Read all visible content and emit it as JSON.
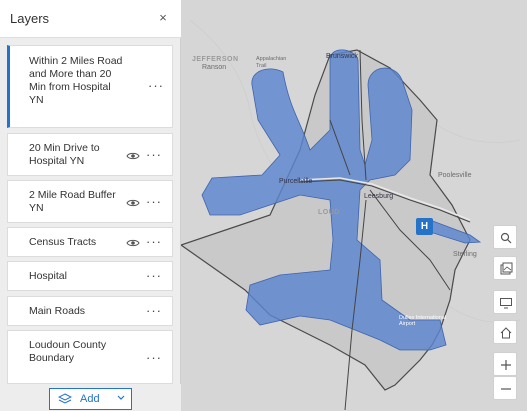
{
  "panel": {
    "title": "Layers",
    "close_glyph": "×",
    "layers": [
      {
        "label": "Within 2 Miles Road and More than 20 Min from Hospital YN",
        "visible_toggle": false,
        "active": true
      },
      {
        "label": "20 Min Drive to Hospital YN",
        "visible_toggle": true
      },
      {
        "label": "2 Mile Road Buffer YN",
        "visible_toggle": true
      },
      {
        "label": "Census Tracts",
        "visible_toggle": true
      },
      {
        "label": "Hospital",
        "visible_toggle": false
      },
      {
        "label": "Main Roads",
        "visible_toggle": false
      },
      {
        "label": "Loudoun County Boundary",
        "visible_toggle": false
      }
    ],
    "more_glyph": "···",
    "add_label": "Add"
  },
  "map": {
    "places": {
      "jefferson": "JEFFERSON",
      "ranson": "Ranson",
      "brunswick": "Brunswick",
      "purcellville": "Purcellville",
      "leesburg": "Leesburg",
      "poolesville": "Poolesville",
      "sterling": "Sterling",
      "loudoun": "LOUD",
      "dulles": "Dulles International Airport",
      "appalachian": "Appalachian Trail"
    },
    "buffer_color": "#5b85d0",
    "hospital_badge": "H",
    "accent_color": "#2473c8"
  },
  "tools": [
    "search",
    "basemap-gallery",
    "screen-toggle",
    "home",
    "zoom-in",
    "zoom-out"
  ]
}
